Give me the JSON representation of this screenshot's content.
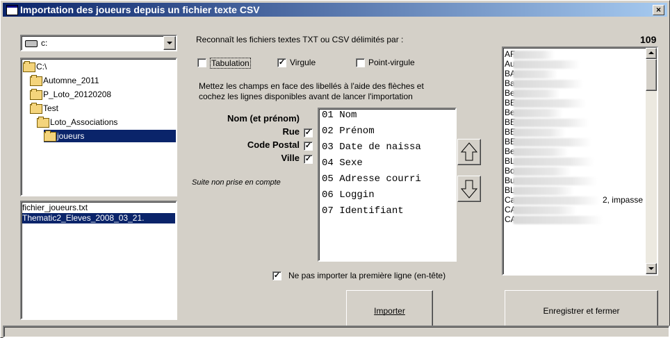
{
  "window": {
    "title": "Importation des joueurs depuis un fichier texte CSV",
    "close_label": "×"
  },
  "drive_select": {
    "value": "c:"
  },
  "folder_tree": [
    {
      "label": "C:\\",
      "selected": false
    },
    {
      "label": "Automne_2011",
      "selected": false
    },
    {
      "label": "P_Loto_20120208",
      "selected": false
    },
    {
      "label": "Test",
      "selected": false
    },
    {
      "label": "Loto_Associations",
      "selected": false
    },
    {
      "label": "joueurs",
      "selected": true
    }
  ],
  "file_list": [
    {
      "label": "fichier_joueurs.txt",
      "selected": false
    },
    {
      "label": "Thematic2_Eleves_2008_03_21.",
      "selected": true
    }
  ],
  "delimiters": {
    "heading": "Reconnaît les fichiers textes TXT ou CSV délimités par :",
    "options": [
      {
        "label": "Tabulation",
        "checked": false
      },
      {
        "label": "Virgule",
        "checked": true
      },
      {
        "label": "Point-virgule",
        "checked": false
      }
    ]
  },
  "count": "109",
  "instructions": {
    "line1": "Mettez les champs en face des libellés à l'aide des flèches et",
    "line2": "cochez les lignes disponibles avant de lancer l'importation"
  },
  "mapping_labels": [
    {
      "label": "Nom (et prénom)",
      "has_checkbox": false,
      "checked": false
    },
    {
      "label": "Rue",
      "has_checkbox": true,
      "checked": true
    },
    {
      "label": "Code Postal",
      "has_checkbox": true,
      "checked": true
    },
    {
      "label": "Ville",
      "has_checkbox": true,
      "checked": true
    }
  ],
  "remainder_note": "Suite non prise en compte",
  "fields": [
    "01 Nom",
    "02 Prénom",
    "03 Date de naissa",
    "04 Sexe",
    "05 Adresse courri",
    "06 Loggin",
    "07 Identifiant"
  ],
  "arrows": {
    "up": "up-arrow-icon",
    "down": "down-arrow-icon"
  },
  "skip_header": {
    "label": "Ne pas importer la première ligne (en-tête)",
    "checked": true
  },
  "buttons": {
    "import": "Importer",
    "save_close": "Enregistrer et fermer"
  },
  "preview": {
    "rows": [
      "AF",
      "Au",
      "BA",
      "Ba",
      "Be",
      "BE",
      "Be",
      "BE",
      "BE",
      "BE",
      "Be",
      "BL",
      "Bo",
      "Bu",
      "BL",
      "Ca",
      "CA",
      "CA"
    ],
    "side_text": "2, impasse",
    "side_text_row": 15
  },
  "colors": {
    "title_start": "#0a246a",
    "title_end": "#a6caf0",
    "selection": "#0a246a",
    "face": "#d4d0c8"
  }
}
